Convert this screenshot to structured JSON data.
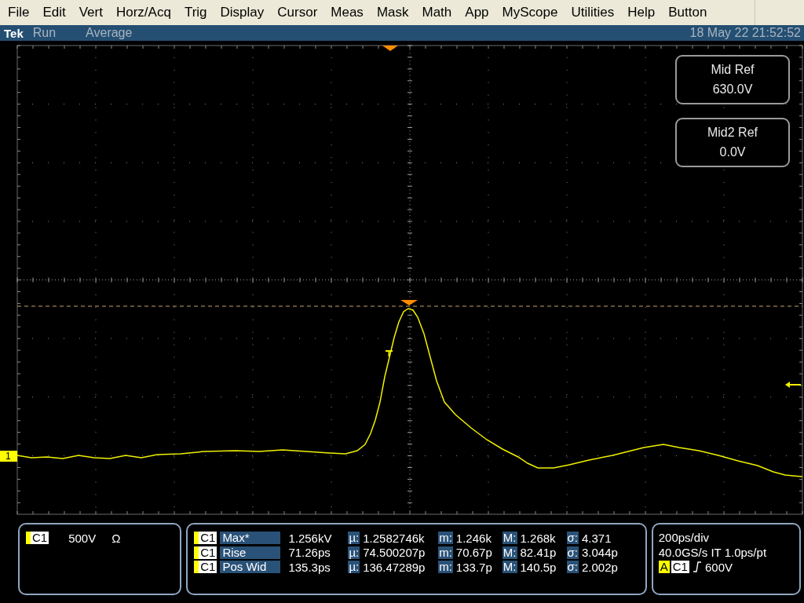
{
  "menu": [
    {
      "label": "File"
    },
    {
      "label": "Edit"
    },
    {
      "label": "Vert"
    },
    {
      "label": "Horz/Acq"
    },
    {
      "label": "Trig"
    },
    {
      "label": "Display"
    },
    {
      "label": "Cursor"
    },
    {
      "label": "Meas"
    },
    {
      "label": "Mask"
    },
    {
      "label": "Math"
    },
    {
      "label": "App"
    },
    {
      "label": "MyScope"
    },
    {
      "label": "Utilities"
    },
    {
      "label": "Help"
    },
    {
      "label": "Button"
    }
  ],
  "status_bar": {
    "brand": "Tek",
    "run_state": "Run",
    "acquisition": "Average",
    "datetime": "18 May 22 21:52:52"
  },
  "display": {
    "channel_marker": "1",
    "reference_boxes": [
      {
        "title": "Mid Ref",
        "value": "630.0V"
      },
      {
        "title": "Mid2 Ref",
        "value": "0.0V"
      }
    ]
  },
  "channel_panel": {
    "channel": "C1",
    "scale": "500V",
    "termination": "Ω"
  },
  "measurements": [
    {
      "channel": "C1",
      "name": "Max*",
      "value": "1.256kV",
      "stats": [
        {
          "label": "µ:",
          "value": "1.2582746k"
        },
        {
          "label": "m:",
          "value": "1.246k"
        },
        {
          "label": "M:",
          "value": "1.268k"
        },
        {
          "label": "σ:",
          "value": "4.371"
        }
      ]
    },
    {
      "channel": "C1",
      "name": "Rise",
      "value": "71.26ps",
      "stats": [
        {
          "label": "µ:",
          "value": "74.500207p"
        },
        {
          "label": "m:",
          "value": "70.67p"
        },
        {
          "label": "M:",
          "value": "82.41p"
        },
        {
          "label": "σ:",
          "value": "3.044p"
        }
      ]
    },
    {
      "channel": "C1",
      "name": "Pos Wid",
      "value": "135.3ps",
      "stats": [
        {
          "label": "µ:",
          "value": "136.47289p"
        },
        {
          "label": "m:",
          "value": "133.7p"
        },
        {
          "label": "M:",
          "value": "140.5p"
        },
        {
          "label": "σ:",
          "value": "2.002p"
        }
      ]
    }
  ],
  "timebase": {
    "scale": "200ps/div",
    "sample_rate": "40.0GS/s IT 1.0ps/pt",
    "trigger_label": "A",
    "trigger_channel": "C1",
    "trigger_level": "600V"
  }
}
